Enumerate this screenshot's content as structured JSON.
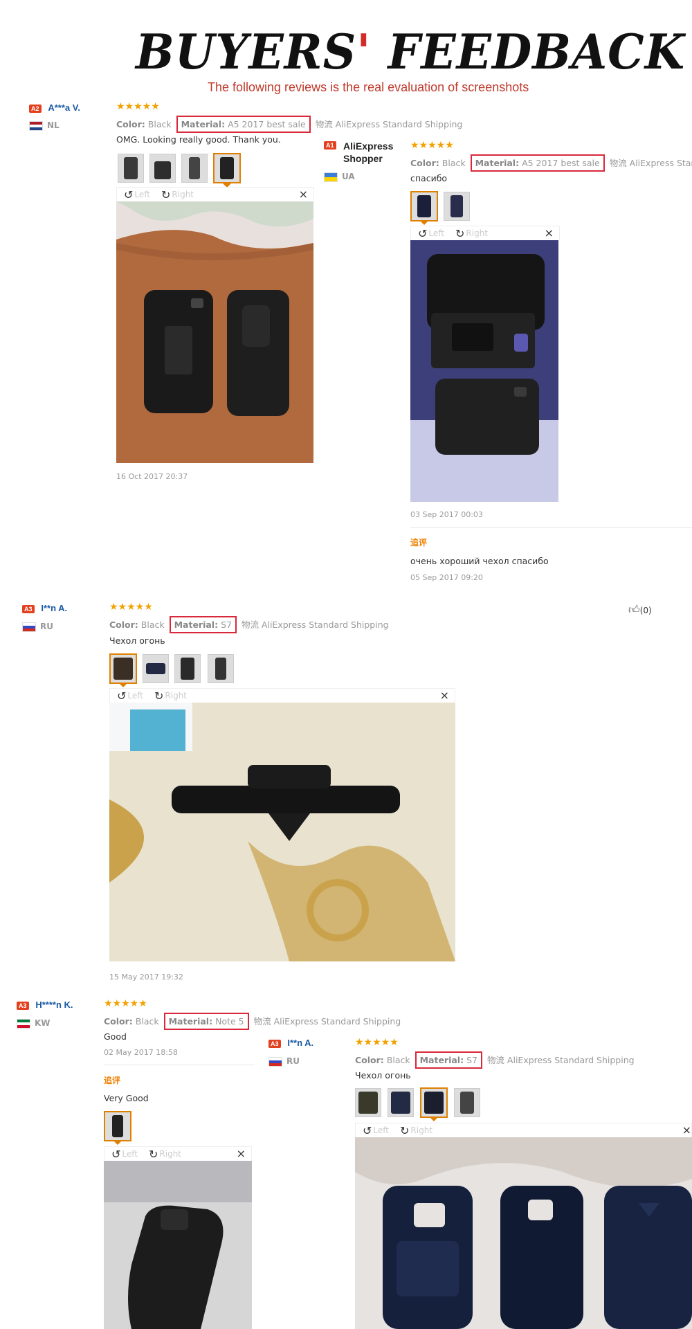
{
  "banner": {
    "title_a": "BUYERS",
    "title_b": "FEEDBACK",
    "subtitle": "The following reviews is the real evaluation of screenshots"
  },
  "common": {
    "stars": "★★★★★",
    "color_label": "Color:",
    "color_value": "Black",
    "material_label": "Material:",
    "shipping": "物流 AliExpress Standard Shipping",
    "left": "Left",
    "right": "Right",
    "close": "×",
    "rot_left": "↺",
    "rot_right": "↻",
    "additional": "追评"
  },
  "reviews": [
    {
      "badge": "A2",
      "name": "A***a V.",
      "country": "NL",
      "material": "A5 2017 best sale",
      "text": "OMG. Looking really good. Thank you.",
      "date": "16 Oct 2017 20:37"
    },
    {
      "badge": "A1",
      "name": "AliExpress Shopper",
      "country": "UA",
      "material": "A5 2017 best sale",
      "shipping": "物流 AliExpress Standar",
      "text": "спасибо",
      "date": "03 Sep 2017 00:03",
      "followup_text": "очень хороший чехол спасибо",
      "followup_date": "05 Sep 2017 09:20"
    },
    {
      "badge": "A3",
      "name": "I**n A.",
      "country": "RU",
      "material": "S7",
      "text": "Чехол огонь",
      "date": "15 May 2017 19:32",
      "helpful": "(0)"
    },
    {
      "badge": "A3",
      "name": "H****n K.",
      "country": "KW",
      "material": "Note 5",
      "text": "Good",
      "date": "02 May 2017 18:58",
      "followup_text": "Very Good"
    },
    {
      "badge": "A3",
      "name": "I**n A.",
      "country": "RU",
      "material": "S7",
      "text": "Чехол огонь"
    }
  ]
}
